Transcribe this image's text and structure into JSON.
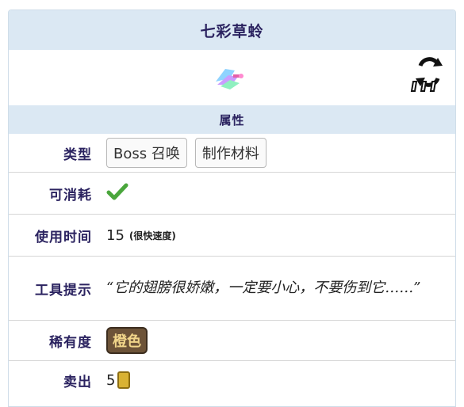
{
  "title": "七彩草蛉",
  "section_title": "属性",
  "icons": {
    "item": "rainbow-dragonfly-icon",
    "autoreuse": "autoreuse-icon"
  },
  "rows": {
    "type": {
      "label": "类型",
      "tags": [
        "Boss 召唤",
        "制作材料"
      ]
    },
    "consumable": {
      "label": "可消耗",
      "value_icon": "checkmark-icon"
    },
    "use_time": {
      "label": "使用时间",
      "value": "15",
      "note": "(很快速度)"
    },
    "tooltip": {
      "label": "工具提示",
      "text": "“它的翅膀很娇嫩，一定要小心，不要伤到它……”"
    },
    "rarity": {
      "label": "稀有度",
      "value": "橙色"
    },
    "sell": {
      "label": "卖出",
      "value": "5"
    }
  },
  "colors": {
    "header_bg": "#dbe8f3",
    "label_text": "#2b2360",
    "check": "#4aa63c",
    "rarity_badge": "#6d5338"
  }
}
